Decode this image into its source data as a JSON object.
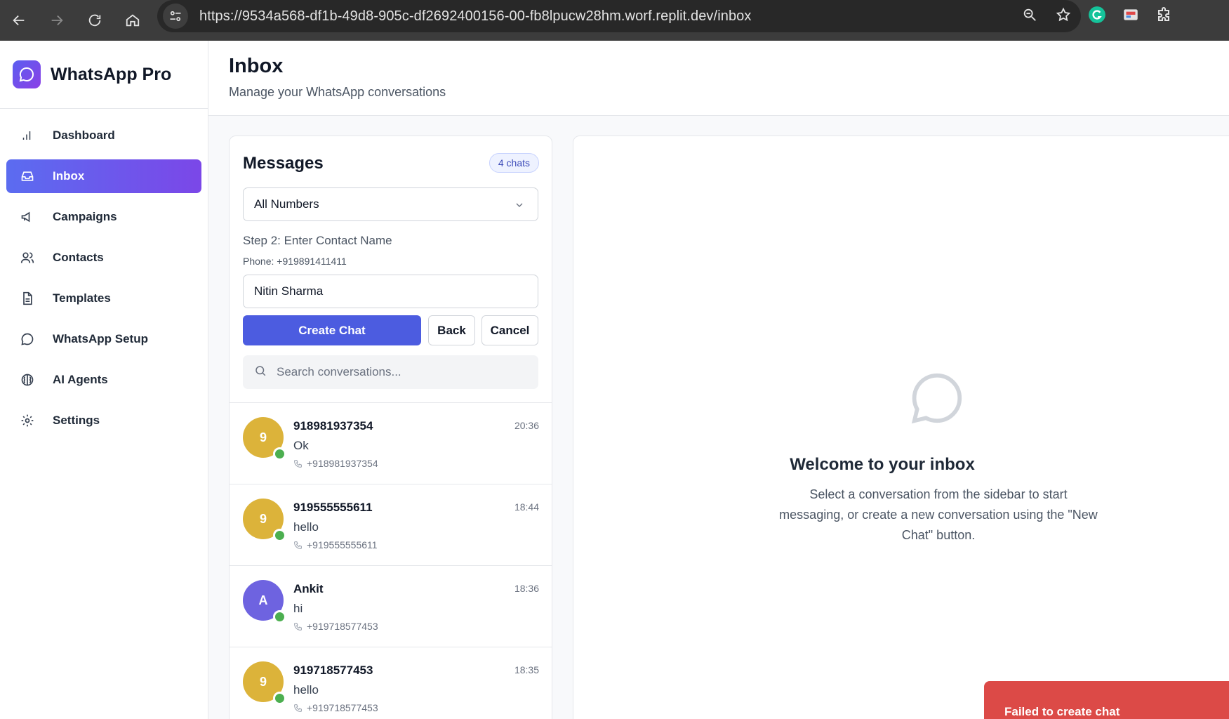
{
  "browser": {
    "url": "https://9534a568-df1b-49d8-905c-df2692400156-00-fb8lpucw28hm.worf.replit.dev/inbox"
  },
  "brand": {
    "name": "WhatsApp Pro"
  },
  "sidebar": {
    "items": [
      {
        "label": "Dashboard",
        "icon": "bar-chart-icon"
      },
      {
        "label": "Inbox",
        "icon": "inbox-icon",
        "active": true
      },
      {
        "label": "Campaigns",
        "icon": "megaphone-icon"
      },
      {
        "label": "Contacts",
        "icon": "users-icon"
      },
      {
        "label": "Templates",
        "icon": "file-text-icon"
      },
      {
        "label": "WhatsApp Setup",
        "icon": "message-circle-icon"
      },
      {
        "label": "AI Agents",
        "icon": "brain-icon"
      },
      {
        "label": "Settings",
        "icon": "gear-icon"
      }
    ]
  },
  "header": {
    "title": "Inbox",
    "subtitle": "Manage your WhatsApp conversations"
  },
  "messages": {
    "title": "Messages",
    "badge": "4 chats",
    "number_select": "All Numbers",
    "step_label": "Step 2: Enter Contact Name",
    "phone_label": "Phone: +919891411411",
    "name_value": "Nitin Sharma",
    "create_label": "Create Chat",
    "back_label": "Back",
    "cancel_label": "Cancel",
    "search_placeholder": "Search conversations...",
    "conversations": [
      {
        "initial": "9",
        "name": "918981937354",
        "time": "20:36",
        "message": "Ok",
        "phone": "+918981937354",
        "color": "#dcb33a"
      },
      {
        "initial": "9",
        "name": "919555555611",
        "time": "18:44",
        "message": "hello",
        "phone": "+919555555611",
        "color": "#dcb33a"
      },
      {
        "initial": "A",
        "name": "Ankit",
        "time": "18:36",
        "message": "hi",
        "phone": "+919718577453",
        "color": "#6e63e0"
      },
      {
        "initial": "9",
        "name": "919718577453",
        "time": "18:35",
        "message": "hello",
        "phone": "+919718577453",
        "color": "#dcb33a"
      }
    ]
  },
  "welcome": {
    "title": "Welcome to your inbox",
    "text": "Select a conversation from the sidebar to start messaging, or create a new conversation using the \"New Chat\" button."
  },
  "toast": {
    "text": "Failed to create chat"
  }
}
